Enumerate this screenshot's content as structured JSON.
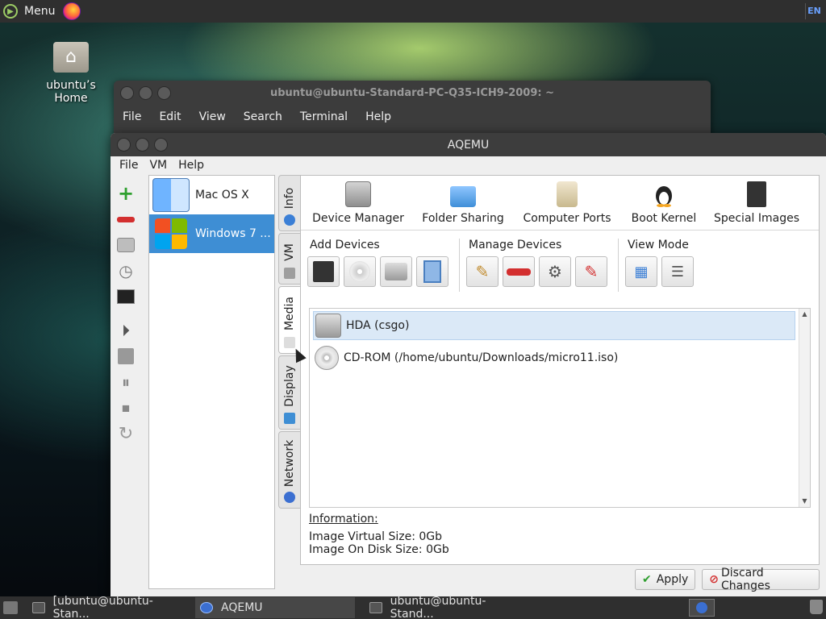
{
  "top_panel": {
    "menu_label": "Menu",
    "keyboard_layout": "EN"
  },
  "desktop": {
    "home_icon_label": "ubuntu’s Home"
  },
  "terminal_window": {
    "title": "ubuntu@ubuntu-Standard-PC-Q35-ICH9-2009: ~",
    "menu": [
      "File",
      "Edit",
      "View",
      "Search",
      "Terminal",
      "Help"
    ]
  },
  "aqemu": {
    "title": "AQEMU",
    "menu": [
      "File",
      "VM",
      "Help"
    ],
    "toolbar_icons": [
      "add-icon",
      "remove-icon",
      "hdd-icon",
      "clock-icon",
      "terminal-icon",
      "play-icon",
      "save-icon",
      "pause-icon",
      "stop-icon",
      "reset-icon"
    ],
    "vm_list": [
      {
        "label": "Mac OS X",
        "selected": false
      },
      {
        "label": "Windows 7 ...",
        "selected": true
      }
    ],
    "vertical_tabs": [
      {
        "label": "Info",
        "active": false
      },
      {
        "label": "VM",
        "active": false
      },
      {
        "label": "Media",
        "active": true
      },
      {
        "label": "Display",
        "active": false
      },
      {
        "label": "Network",
        "active": false
      }
    ],
    "device_tabs": [
      "Device Manager",
      "Folder Sharing",
      "Computer Ports",
      "Boot Kernel",
      "Special Images"
    ],
    "groups": {
      "add_devices": "Add Devices",
      "manage_devices": "Manage Devices",
      "view_mode": "View Mode"
    },
    "devices": [
      {
        "label": "HDA (csgo)",
        "type": "hdd",
        "selected": true
      },
      {
        "label": "CD-ROM (/home/ubuntu/Downloads/micro11.iso)",
        "type": "cdrom",
        "selected": false
      }
    ],
    "information": {
      "title": "Information:",
      "virtual_size": "Image Virtual Size: 0Gb",
      "disk_size": "Image On Disk Size: 0Gb"
    },
    "buttons": {
      "apply": "Apply",
      "discard": "Discard Changes"
    }
  },
  "taskbar": {
    "tasks": [
      {
        "label": "[ubuntu@ubuntu-Stan...",
        "active": false
      },
      {
        "label": "AQEMU",
        "active": true
      },
      {
        "label": "ubuntu@ubuntu-Stand...",
        "active": false
      }
    ]
  }
}
